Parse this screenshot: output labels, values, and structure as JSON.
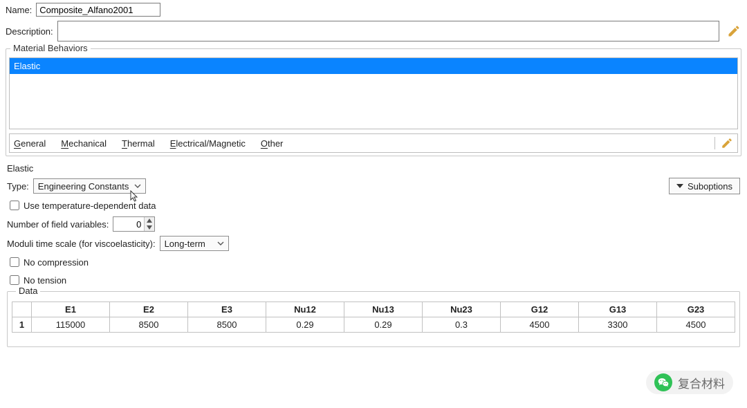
{
  "header": {
    "name_label": "Name:",
    "name_value": "Composite_Alfano2001",
    "description_label": "Description:",
    "description_value": ""
  },
  "behaviors": {
    "legend": "Material Behaviors",
    "items": [
      "Elastic"
    ]
  },
  "behavior_tabs": {
    "general": "General",
    "mechanical": "Mechanical",
    "thermal": "Thermal",
    "electrical": "Electrical/Magnetic",
    "other": "Other"
  },
  "elastic": {
    "section_title": "Elastic",
    "type_label": "Type:",
    "type_value": "Engineering Constants",
    "suboptions_label": "Suboptions",
    "use_temp_label": "Use temperature-dependent data",
    "field_vars_label": "Number of field variables:",
    "field_vars_value": "0",
    "moduli_label": "Moduli time scale (for viscoelasticity):",
    "moduli_value": "Long-term",
    "no_compression_label": "No compression",
    "no_tension_label": "No tension"
  },
  "data": {
    "legend": "Data",
    "columns": [
      "E1",
      "E2",
      "E3",
      "Nu12",
      "Nu13",
      "Nu23",
      "G12",
      "G13",
      "G23"
    ],
    "rows": [
      {
        "idx": "1",
        "values": [
          "115000",
          "8500",
          "8500",
          "0.29",
          "0.29",
          "0.3",
          "4500",
          "3300",
          "4500"
        ]
      }
    ]
  },
  "watermark": {
    "text": "复合材料"
  },
  "chart_data": {
    "type": "table",
    "title": "Elastic Engineering Constants",
    "columns": [
      "E1",
      "E2",
      "E3",
      "Nu12",
      "Nu13",
      "Nu23",
      "G12",
      "G13",
      "G23"
    ],
    "rows": [
      [
        115000,
        8500,
        8500,
        0.29,
        0.29,
        0.3,
        4500,
        3300,
        4500
      ]
    ]
  }
}
